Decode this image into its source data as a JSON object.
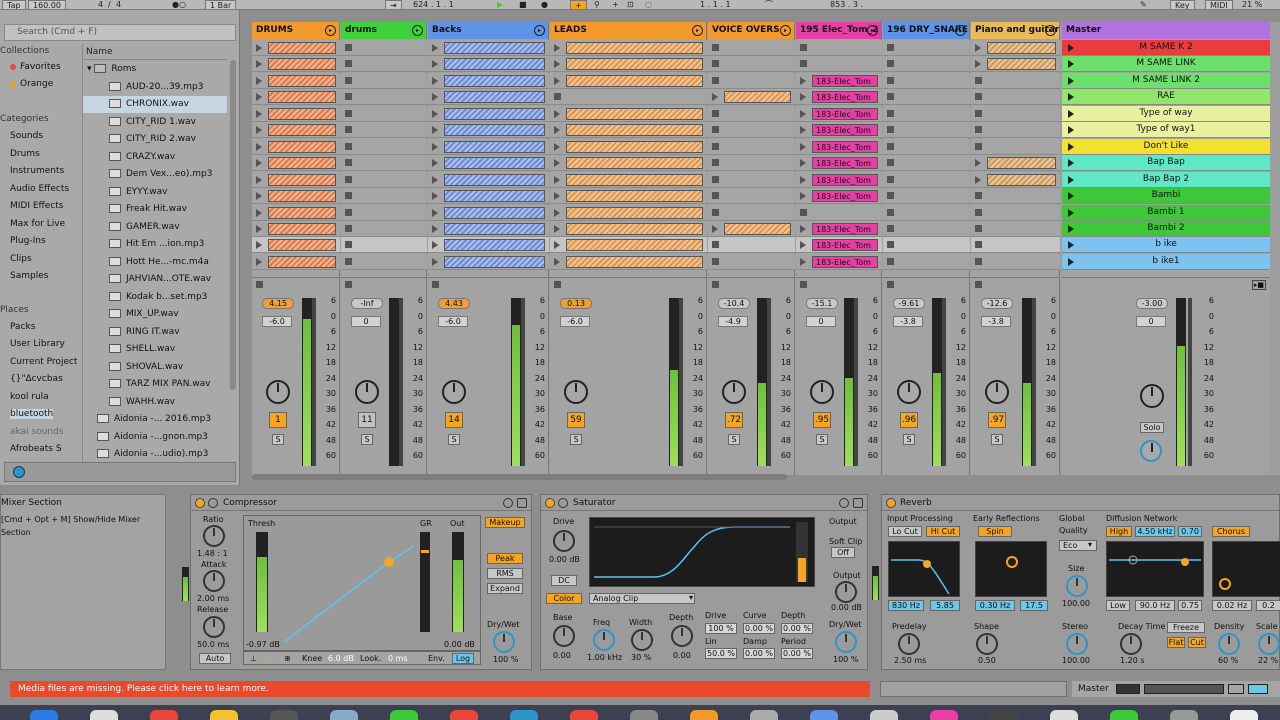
{
  "transport": {
    "tap": "Tap",
    "tempo": "160.00",
    "sig_num": "4",
    "sig_den": "4",
    "quant": "1 Bar",
    "pos": "624 .  1 .  1",
    "loop_start": "1 .  1 .  1",
    "loop_len": "853 .  3 .",
    "key": "Key",
    "midi": "MIDI",
    "cpu": "21 %"
  },
  "browser": {
    "search_placeholder": "Search (Cmd + F)",
    "collections_header": "Collections",
    "collections": [
      {
        "label": "Favorites",
        "color": "#e8463a"
      },
      {
        "label": "Orange",
        "color": "#f39a1f"
      }
    ],
    "categories_header": "Categories",
    "categories": [
      "Sounds",
      "Drums",
      "Instruments",
      "Audio Effects",
      "MIDI Effects",
      "Max for Live",
      "Plug-Ins",
      "Clips",
      "Samples"
    ],
    "places_header": "Places",
    "places": [
      "Packs",
      "User Library",
      "Current Project",
      "{}\"∆cvcbas",
      "kool rula",
      "bluetooth",
      "akai sounds",
      "Afrobeats S"
    ],
    "name_header": "Name",
    "folder": "Roms",
    "files": [
      "AUD-20...39.mp3",
      "CHRONIX.wav",
      "CITY_RID 1.wav",
      "CITY_RID 2.wav",
      "CRAZY.wav",
      "Dem Vex...eo).mp3",
      "EYYY.wav",
      "Freak Hit.wav",
      "GAMER.wav",
      "Hit Em ...ion.mp3",
      "Hott He...-mc.m4a",
      "JAHVIAN...OTE.wav",
      "Kodak b...set.mp3",
      "MIX_UP.wav",
      "RING IT.wav",
      "SHELL.wav",
      "SHOVAL.wav",
      "TARZ MIX PAN.wav",
      "WAHH.wav"
    ],
    "root_files": [
      "Aidonia -... 2016.mp3",
      "Aidonia -...gnon.mp3",
      "Aidonia -...udio).mp3"
    ],
    "selected_file": "CHRONIX.wav"
  },
  "tracks": [
    {
      "name": "DRUMS",
      "color": "#f39a2c",
      "clip_color": "#e07a45",
      "vol": "4.15",
      "pan": "-6.0",
      "num": "1",
      "num_on": true,
      "clips": [
        1,
        1,
        1,
        1,
        1,
        1,
        1,
        1,
        1,
        1,
        1,
        1,
        1,
        1
      ],
      "meter": 0.92,
      "fill_vol": true
    },
    {
      "name": "drums",
      "color": "#3ed13b",
      "clip_color": "#a8a8a8",
      "vol": "-Inf",
      "pan": "0",
      "num": "11",
      "num_on": false,
      "clips": [
        0,
        0,
        0,
        0,
        0,
        0,
        0,
        0,
        0,
        0,
        0,
        0,
        0,
        0
      ],
      "meter": 0.0,
      "fill_vol": false
    },
    {
      "name": "Backs",
      "color": "#5f93e8",
      "clip_color": "#6d8bd6",
      "vol": "4.43",
      "pan": "-6.0",
      "num": "14",
      "num_on": true,
      "clips": [
        1,
        1,
        1,
        1,
        1,
        1,
        1,
        1,
        1,
        1,
        1,
        1,
        1,
        1
      ],
      "meter": 0.88,
      "fill_vol": true
    },
    {
      "name": "LEADS",
      "color": "#f39a2c",
      "clip_color": "#e0954d",
      "vol": "0.13",
      "pan": "-6.0",
      "num": "59",
      "num_on": true,
      "clips": [
        1,
        1,
        1,
        0,
        1,
        1,
        1,
        1,
        1,
        1,
        1,
        1,
        1,
        1
      ],
      "meter": 0.6,
      "fill_vol": true
    },
    {
      "name": "VOICE OVERS",
      "color": "#f39a2c",
      "clip_color": "#e0954d",
      "vol": "-10.4",
      "pan": "-4.9",
      "num": ".72",
      "num_on": true,
      "clips": [
        0,
        0,
        0,
        1,
        0,
        0,
        0,
        0,
        0,
        0,
        0,
        1,
        0,
        0
      ],
      "meter": 0.52,
      "fill_vol": false
    },
    {
      "name": "195 Elec_Tom_2",
      "color": "#e83fa4",
      "clip_color": "#e83fa4",
      "vol": "-15.1",
      "pan": "0",
      "num": ".95",
      "num_on": true,
      "clips": [
        0,
        0,
        1,
        1,
        1,
        1,
        1,
        1,
        1,
        1,
        0,
        1,
        1,
        1
      ],
      "meter": 0.55,
      "fill_vol": false,
      "clip_label": "183-Elec_Tom"
    },
    {
      "name": "196 DRY_SNARE",
      "color": "#5f93e8",
      "clip_color": "#5f93e8",
      "vol": "-9.61",
      "pan": "-3.8",
      "num": ".96",
      "num_on": true,
      "clips": [
        0,
        0,
        0,
        0,
        0,
        0,
        0,
        0,
        0,
        0,
        0,
        0,
        0,
        0
      ],
      "meter": 0.58,
      "fill_vol": false
    },
    {
      "name": "Piano and guitar",
      "color": "#e8ba5a",
      "clip_color": "#cf9a55",
      "vol": "-12.6",
      "pan": "-3.8",
      "num": ".97",
      "num_on": true,
      "clips": [
        1,
        1,
        0,
        0,
        0,
        0,
        0,
        1,
        1,
        0,
        0,
        0,
        0,
        0
      ],
      "meter": 0.52,
      "fill_vol": false
    }
  ],
  "master": {
    "name": "Master",
    "color": "#b273e0",
    "vol": "-3.00",
    "pan": "0",
    "solo": "Solo",
    "scenes": [
      {
        "label": "M SAME K 2",
        "color": "#ea3c3c"
      },
      {
        "label": "M SAME LINK",
        "color": "#6be06b"
      },
      {
        "label": "M SAME LINK 2",
        "color": "#6be06b"
      },
      {
        "label": "RAE",
        "color": "#8fe66b"
      },
      {
        "label": "Type of way",
        "color": "#e9f0a0"
      },
      {
        "label": "Type of way1",
        "color": "#e9f0a0"
      },
      {
        "label": "Don't Like",
        "color": "#f3e02f"
      },
      {
        "label": "Bap Bap",
        "color": "#5ee8c8"
      },
      {
        "label": "Bap Bap 2",
        "color": "#5ee8c8"
      },
      {
        "label": "Bambi",
        "color": "#3fc73a"
      },
      {
        "label": "Bambi 1",
        "color": "#3fc73a"
      },
      {
        "label": "Bambi 2",
        "color": "#3fc73a"
      },
      {
        "label": "b ike",
        "color": "#7cc3f0"
      },
      {
        "label": "b ike1",
        "color": "#7cc3f0"
      }
    ]
  },
  "meter_scale": [
    "6",
    "0",
    "6",
    "12",
    "18",
    "24",
    "30",
    "36",
    "42",
    "48",
    "60"
  ],
  "info": {
    "title": "Mixer Section",
    "text1": "[Cmd + Opt + M] Show/Hide Mixer",
    "text2": "Section"
  },
  "compressor": {
    "title": "Compressor",
    "ratio_label": "Ratio",
    "ratio": "1.48 : 1",
    "attack_label": "Attack",
    "attack": "2.00 ms",
    "release_label": "Release",
    "release": "50.0 ms",
    "auto": "Auto",
    "thresh_label": "Thresh",
    "thresh_val": "-0.97 dB",
    "gr_label": "GR",
    "out_label": "Out",
    "out_val": "0.00 dB",
    "makeup": "Makeup",
    "peak": "Peak",
    "rms": "RMS",
    "expand": "Expand",
    "knee_label": "Knee",
    "knee": "6.0 dB",
    "look_label": "Look.",
    "look": "0 ms",
    "env_label": "Env.",
    "env": "Log",
    "drywet_label": "Dry/Wet",
    "drywet": "100 %"
  },
  "saturator": {
    "title": "Saturator",
    "drive_label": "Drive",
    "drive": "0.00 dB",
    "dc": "DC",
    "color_btn": "Color",
    "mode": "Analog Clip",
    "base_label": "Base",
    "base": "0.00",
    "freq_label": "Freq",
    "freq": "1.00 kHz",
    "width_label": "Width",
    "width": "30 %",
    "depth_label": "Depth",
    "depth": "0.00",
    "drive2_label": "Drive",
    "drive2": "100 %",
    "lin_label": "Lin",
    "lin": "50.0 %",
    "curve_label": "Curve",
    "curve": "0.00 %",
    "damp_label": "Damp",
    "damp": "0.00 %",
    "depth2_label": "Depth",
    "depth2": "0.00 %",
    "period_label": "Period",
    "period": "0.00 %",
    "output_hdr": "Output",
    "softclip_label": "Soft Clip",
    "softclip": "Off",
    "output_label": "Output",
    "output": "0.00 dB",
    "drywet_label": "Dry/Wet",
    "drywet": "100 %"
  },
  "reverb": {
    "title": "Reverb",
    "input_label": "Input Processing",
    "locut": "Lo Cut",
    "hicut": "Hi Cut",
    "freq_a": "830 Hz",
    "width_a": "5.85",
    "predelay_label": "Predelay",
    "predelay": "2.50 ms",
    "early_label": "Early Reflections",
    "spin": "Spin",
    "er_freq": "0.30 Hz",
    "er_amt": "17.5",
    "shape_label": "Shape",
    "shape": "0.50",
    "global_label": "Global",
    "quality_label": "Quality",
    "quality": "Eco",
    "size_label": "Size",
    "size": "100.00",
    "stereo_label": "Stereo",
    "stereo": "100.00",
    "diff_label": "Diffusion Network",
    "high": "High",
    "high_freq": "4.50 kHz",
    "high_amt": "0.70",
    "chorus": "Chorus",
    "low": "Low",
    "low_freq": "90.0 Hz",
    "low_amt": "0.75",
    "ch_amt": "0.02 Hz",
    "ch_amt2": "0.2",
    "decay_label": "Decay Time",
    "decay": "1.20 s",
    "freeze": "Freeze",
    "flat": "Flat",
    "cut": "Cut",
    "density_label": "Density",
    "density": "60 %",
    "scale_label": "Scale",
    "scale": "22 %"
  },
  "status": {
    "message": "Media files are missing. Please click here to learn more.",
    "master_label": "Master"
  }
}
